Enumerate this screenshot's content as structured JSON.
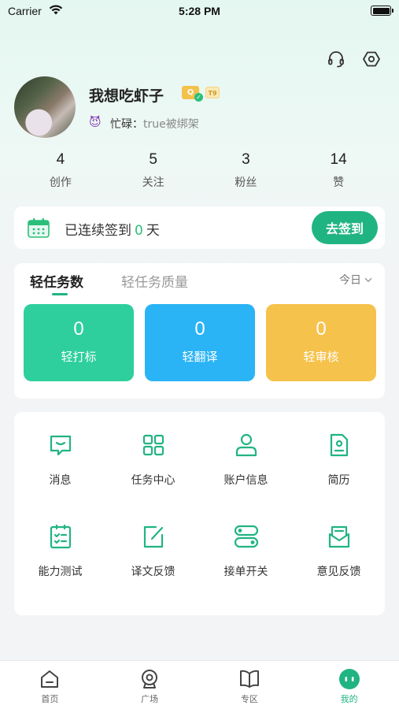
{
  "status_bar": {
    "carrier": "Carrier",
    "time": "5:28 PM"
  },
  "header": {
    "icons": [
      "headset-icon",
      "settings-icon"
    ]
  },
  "profile": {
    "username": "我想吃虾子",
    "badge_q": "Q",
    "level_badge": "T9",
    "mood_emoji": "😈",
    "mood_label": "忙碌：",
    "mood_text": "true被绑架"
  },
  "stats": [
    {
      "value": "4",
      "label": "创作"
    },
    {
      "value": "5",
      "label": "关注"
    },
    {
      "value": "3",
      "label": "粉丝"
    },
    {
      "value": "14",
      "label": "赞"
    }
  ],
  "checkin": {
    "prefix": "已连续签到",
    "days": "0",
    "suffix": "天",
    "button": "去签到"
  },
  "tasks": {
    "tab_active": "轻任务数",
    "tab_inactive": "轻任务质量",
    "period": "今日",
    "tiles": [
      {
        "value": "0",
        "label": "轻打标",
        "color": "#2ecf9c"
      },
      {
        "value": "0",
        "label": "轻翻译",
        "color": "#2bb4f5"
      },
      {
        "value": "0",
        "label": "轻审核",
        "color": "#f5c24c"
      }
    ]
  },
  "menu": [
    {
      "label": "消息",
      "icon": "message-icon"
    },
    {
      "label": "任务中心",
      "icon": "grid-icon"
    },
    {
      "label": "账户信息",
      "icon": "user-icon"
    },
    {
      "label": "简历",
      "icon": "resume-icon"
    },
    {
      "label": "能力测试",
      "icon": "checklist-icon"
    },
    {
      "label": "译文反馈",
      "icon": "edit-icon"
    },
    {
      "label": "接单开关",
      "icon": "toggle-icon"
    },
    {
      "label": "意见反馈",
      "icon": "feedback-icon"
    }
  ],
  "colors": {
    "accent": "#21b483",
    "accent_light": "#2ecf9c"
  },
  "tabbar": [
    {
      "label": "首页",
      "icon": "home-icon",
      "active": false
    },
    {
      "label": "广场",
      "icon": "plaza-icon",
      "active": false
    },
    {
      "label": "专区",
      "icon": "book-icon",
      "active": false
    },
    {
      "label": "我的",
      "icon": "profile-icon",
      "active": true
    }
  ]
}
